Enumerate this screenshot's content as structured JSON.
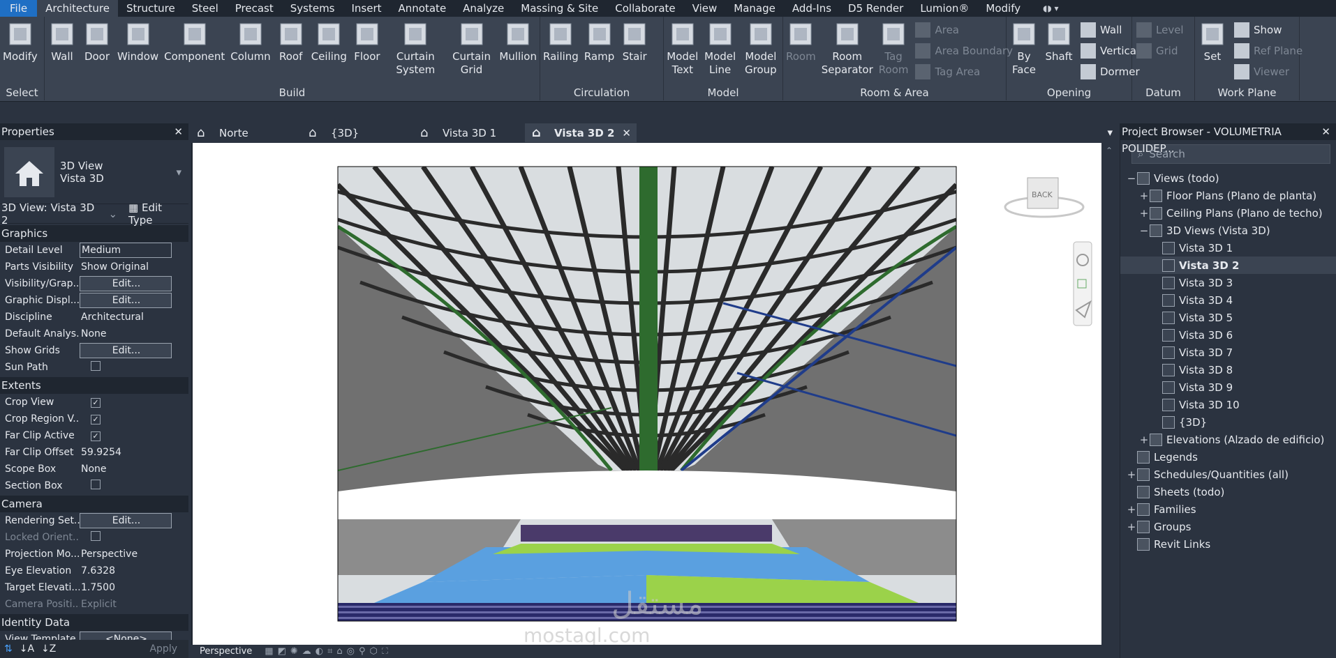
{
  "menubar": {
    "tabs": [
      "File",
      "Architecture",
      "Structure",
      "Steel",
      "Precast",
      "Systems",
      "Insert",
      "Annotate",
      "Analyze",
      "Massing & Site",
      "Collaborate",
      "View",
      "Manage",
      "Add-Ins",
      "D5 Render",
      "Lumion®",
      "Modify"
    ]
  },
  "ribbon": {
    "select": {
      "tool": "Modify",
      "label": "Select"
    },
    "build": {
      "label": "Build",
      "tools": [
        "Wall",
        "Door",
        "Window",
        "Component",
        "Column",
        "Roof",
        "Ceiling",
        "Floor",
        "Curtain System",
        "Curtain Grid",
        "Mullion"
      ]
    },
    "circulation": {
      "label": "Circulation",
      "tools": [
        "Railing",
        "Ramp",
        "Stair"
      ]
    },
    "model": {
      "label": "Model",
      "tools": [
        "Model Text",
        "Model Line",
        "Model Group"
      ]
    },
    "room_area": {
      "label": "Room & Area",
      "tools": [
        "Room",
        "Room Separator",
        "Tag Room"
      ],
      "small": [
        "Area",
        "Area Boundary",
        "Tag Area"
      ]
    },
    "opening": {
      "label": "Opening",
      "tools": [
        "By Face",
        "Shaft"
      ],
      "small": [
        "Wall",
        "Vertical",
        "Dormer"
      ]
    },
    "datum": {
      "label": "Datum",
      "small": [
        "Level",
        "Grid"
      ]
    },
    "work_plane": {
      "label": "Work Plane",
      "tools": [
        "Set"
      ],
      "small": [
        "Show",
        "Ref Plane",
        "Viewer"
      ]
    }
  },
  "properties": {
    "title": "Properties",
    "type_line1": "3D View",
    "type_line2": "Vista 3D",
    "selector": "3D View: Vista 3D 2",
    "edit_type": "Edit Type",
    "sections": [
      {
        "name": "Graphics",
        "rows": [
          {
            "k": "Detail Level",
            "v": "Medium",
            "kind": "box"
          },
          {
            "k": "Parts Visibility",
            "v": "Show Original",
            "kind": "text"
          },
          {
            "k": "Visibility/Grap...",
            "v": "Edit...",
            "kind": "btn"
          },
          {
            "k": "Graphic Displ...",
            "v": "Edit...",
            "kind": "btn"
          },
          {
            "k": "Discipline",
            "v": "Architectural",
            "kind": "text"
          },
          {
            "k": "Default Analys...",
            "v": "None",
            "kind": "text"
          },
          {
            "k": "Show Grids",
            "v": "Edit...",
            "kind": "btn"
          },
          {
            "k": "Sun Path",
            "v": "",
            "kind": "cb"
          }
        ]
      },
      {
        "name": "Extents",
        "rows": [
          {
            "k": "Crop View",
            "v": "✓",
            "kind": "cb"
          },
          {
            "k": "Crop Region V...",
            "v": "✓",
            "kind": "cb"
          },
          {
            "k": "Far Clip Active",
            "v": "✓",
            "kind": "cb"
          },
          {
            "k": "Far Clip Offset",
            "v": "59.9254",
            "kind": "text"
          },
          {
            "k": "Scope Box",
            "v": "None",
            "kind": "text"
          },
          {
            "k": "Section Box",
            "v": "",
            "kind": "cb"
          }
        ]
      },
      {
        "name": "Camera",
        "rows": [
          {
            "k": "Rendering Set...",
            "v": "Edit...",
            "kind": "btn"
          },
          {
            "k": "Locked Orient...",
            "v": "",
            "kind": "cb",
            "dim": true
          },
          {
            "k": "Projection Mo...",
            "v": "Perspective",
            "kind": "text"
          },
          {
            "k": "Eye Elevation",
            "v": "7.6328",
            "kind": "text"
          },
          {
            "k": "Target Elevati...",
            "v": "1.7500",
            "kind": "text"
          },
          {
            "k": "Camera Positi...",
            "v": "Explicit",
            "kind": "text",
            "dim": true
          }
        ]
      },
      {
        "name": "Identity Data",
        "rows": [
          {
            "k": "View Template",
            "v": "<None>",
            "kind": "btn"
          }
        ]
      }
    ],
    "apply": "Apply"
  },
  "view_tabs": [
    {
      "label": "Norte",
      "active": false
    },
    {
      "label": "{3D}",
      "active": false
    },
    {
      "label": "Vista 3D 1",
      "active": false
    },
    {
      "label": "Vista 3D 2",
      "active": true
    }
  ],
  "viewcube": {
    "face": "BACK"
  },
  "status": {
    "mode": "Perspective"
  },
  "project_browser": {
    "title": "Project Browser - VOLUMETRIA POLIDEP...",
    "search_placeholder": "Search",
    "tree": [
      {
        "label": "Views (todo)",
        "lvl": 0,
        "tgl": "−"
      },
      {
        "label": "Floor Plans (Plano de planta)",
        "lvl": 1,
        "tgl": "+"
      },
      {
        "label": "Ceiling Plans (Plano de techo)",
        "lvl": 1,
        "tgl": "+"
      },
      {
        "label": "3D Views (Vista 3D)",
        "lvl": 1,
        "tgl": "−"
      },
      {
        "label": "Vista 3D 1",
        "lvl": 2
      },
      {
        "label": "Vista 3D 2",
        "lvl": 2,
        "sel": true
      },
      {
        "label": "Vista 3D 3",
        "lvl": 2
      },
      {
        "label": "Vista 3D 4",
        "lvl": 2
      },
      {
        "label": "Vista 3D 5",
        "lvl": 2
      },
      {
        "label": "Vista 3D 6",
        "lvl": 2
      },
      {
        "label": "Vista 3D 7",
        "lvl": 2
      },
      {
        "label": "Vista 3D 8",
        "lvl": 2
      },
      {
        "label": "Vista 3D 9",
        "lvl": 2
      },
      {
        "label": "Vista 3D 10",
        "lvl": 2
      },
      {
        "label": "{3D}",
        "lvl": 2
      },
      {
        "label": "Elevations (Alzado de edificio)",
        "lvl": 1,
        "tgl": "+"
      },
      {
        "label": "Legends",
        "lvl": 0
      },
      {
        "label": "Schedules/Quantities (all)",
        "lvl": 0,
        "tgl": "+"
      },
      {
        "label": "Sheets (todo)",
        "lvl": 0
      },
      {
        "label": "Families",
        "lvl": 0,
        "tgl": "+"
      },
      {
        "label": "Groups",
        "lvl": 0,
        "tgl": "+"
      },
      {
        "label": "Revit Links",
        "lvl": 0
      }
    ]
  },
  "watermark": {
    "line1": "مستقل",
    "line2": "mostaql.com"
  }
}
